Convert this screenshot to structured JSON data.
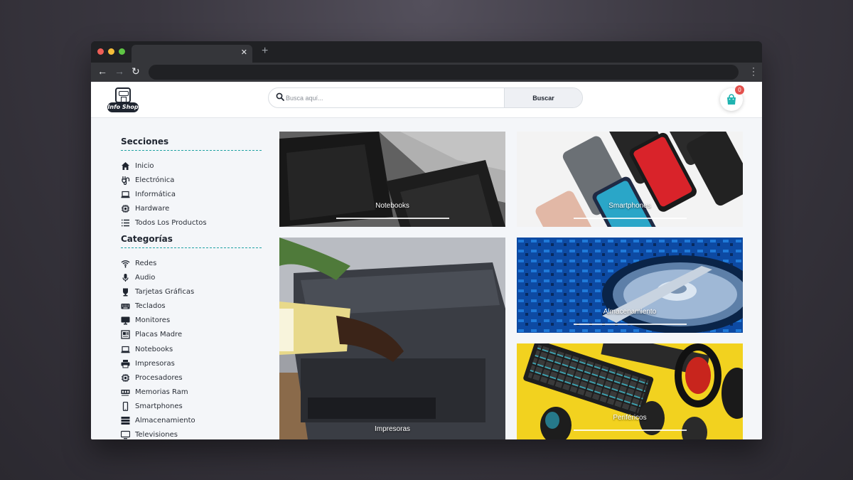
{
  "site": {
    "logo_text": "Info Shop",
    "search_placeholder": "Busca aquí...",
    "search_button": "Buscar",
    "cart_count": "0"
  },
  "sidebar": {
    "sections_title": "Secciones",
    "sections": [
      {
        "label": "Inicio",
        "icon": "home-icon"
      },
      {
        "label": "Electrónica",
        "icon": "plug-icon"
      },
      {
        "label": "Informática",
        "icon": "laptop-icon"
      },
      {
        "label": "Hardware",
        "icon": "chip-icon"
      },
      {
        "label": "Todos Los Productos",
        "icon": "list-icon"
      }
    ],
    "categories_title": "Categorías",
    "categories": [
      {
        "label": "Redes",
        "icon": "wifi-icon"
      },
      {
        "label": "Audio",
        "icon": "microphone-icon"
      },
      {
        "label": "Tarjetas Gráficas",
        "icon": "gpu-icon"
      },
      {
        "label": "Teclados",
        "icon": "keyboard-icon"
      },
      {
        "label": "Monitores",
        "icon": "monitor-icon"
      },
      {
        "label": "Placas Madre",
        "icon": "motherboard-icon"
      },
      {
        "label": "Notebooks",
        "icon": "notebook-icon"
      },
      {
        "label": "Impresoras",
        "icon": "printer-icon"
      },
      {
        "label": "Procesadores",
        "icon": "processor-icon"
      },
      {
        "label": "Memorias Ram",
        "icon": "memory-icon"
      },
      {
        "label": "Smartphones",
        "icon": "smartphone-icon"
      },
      {
        "label": "Almacenamiento",
        "icon": "storage-icon"
      },
      {
        "label": "Televisiones",
        "icon": "tv-icon"
      }
    ]
  },
  "cards": [
    {
      "label": "Notebooks"
    },
    {
      "label": "Smartphones"
    },
    {
      "label": "Impresoras"
    },
    {
      "label": "Almacenamiento"
    },
    {
      "label": "Periféricos"
    }
  ]
}
